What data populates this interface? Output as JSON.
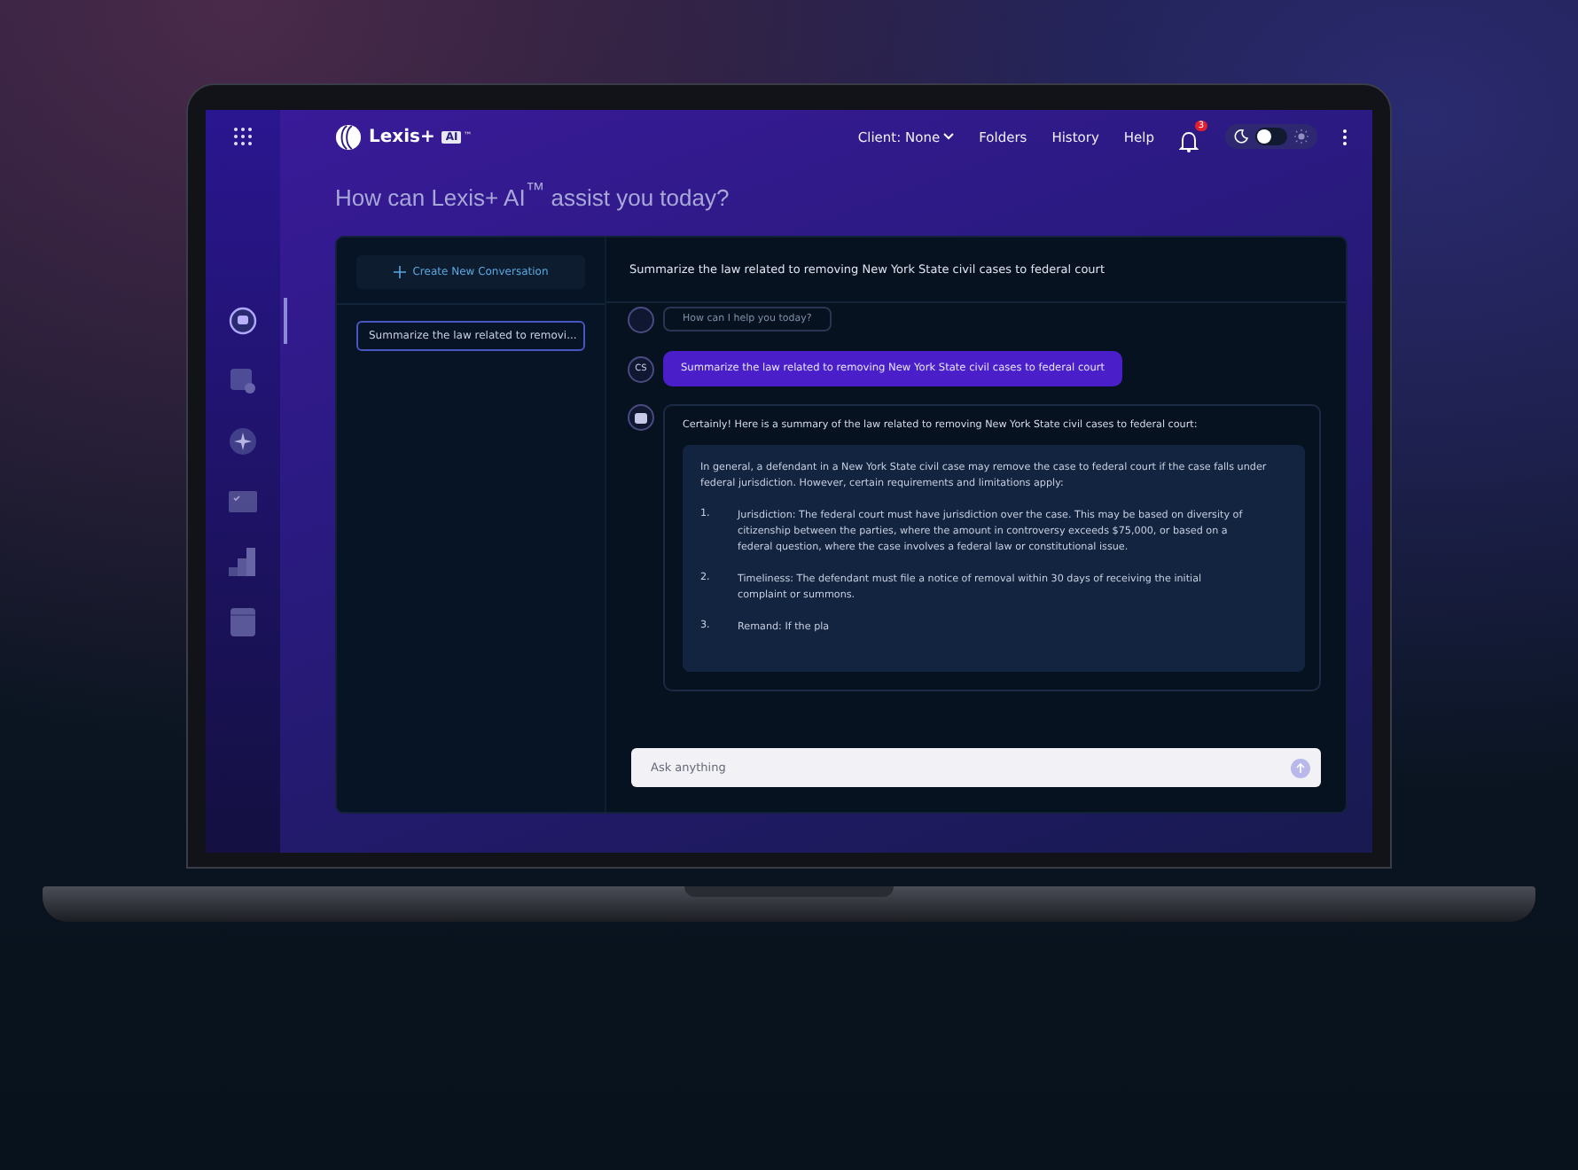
{
  "app": {
    "logo_text": "Lexis+",
    "logo_badge": "AI",
    "logo_mark": "™"
  },
  "nav": [
    {
      "label": "Client: None",
      "dropdown": true
    },
    {
      "label": "Folders",
      "dropdown": false
    },
    {
      "label": "History",
      "dropdown": false
    },
    {
      "label": "Help",
      "dropdown": false
    }
  ],
  "notifications": {
    "count": "3"
  },
  "theme_toggle": {
    "dark": true
  },
  "heading": "How can Lexis+ AI$^{™}$ assist you today?",
  "rail": [
    {
      "kind": "chat",
      "selected": true
    },
    {
      "kind": "search",
      "selected": false
    },
    {
      "kind": "sparkle",
      "selected": false
    },
    {
      "kind": "folder",
      "selected": false
    },
    {
      "kind": "chart",
      "selected": false
    },
    {
      "kind": "document",
      "selected": false
    }
  ],
  "new_conversation": "Create New Conversation",
  "conversations": [
    {
      "label": "Summarize the law related to removi...",
      "selected": true
    }
  ],
  "chat_title": "Summarize the law related to removing New York State civil cases to federal court",
  "messages": [
    {
      "kind": "assistant",
      "text": "How can I help you today?"
    },
    {
      "kind": "user",
      "initials": "CS",
      "text": "Summarize the law related to removing New York State civil cases to federal court"
    },
    {
      "kind": "answer",
      "intro": "Certainly! Here is a summary of the law related to removing New York State civil cases to federal court:",
      "body": "In general, a defendant in a New York State civil case may remove the case to federal court if the case falls under federal jurisdiction. However, certain requirements and limitations apply:",
      "items": [
        {
          "number": "1.",
          "text": "Jurisdiction: The federal court must have jurisdiction over the case. This may be based on diversity of citizenship between the parties, where the amount in controversy exceeds $75,000, or based on a federal question, where the case involves a federal law or constitutional issue."
        },
        {
          "number": "2.",
          "text": "Timeliness: The defendant must file a notice of removal within 30 days of receiving the initial complaint or summons."
        },
        {
          "number": "3.",
          "text": "Remand: If the pla"
        }
      ]
    }
  ],
  "input": {
    "placeholder": "Ask anything"
  }
}
